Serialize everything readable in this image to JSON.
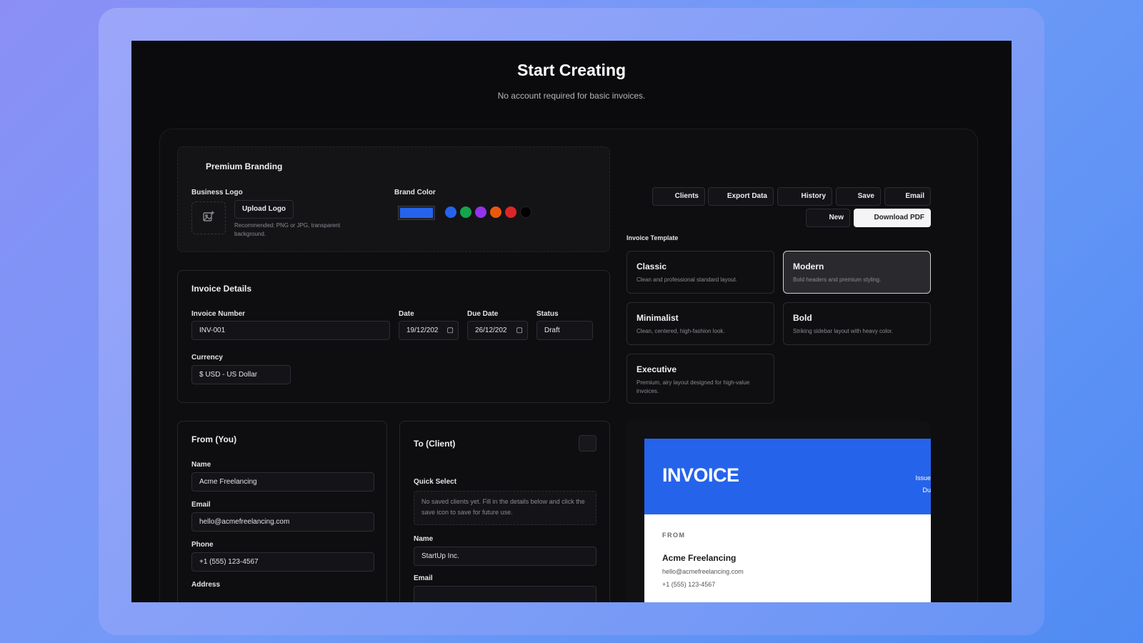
{
  "hero": {
    "title": "Start Creating",
    "subtitle": "No account required for basic invoices."
  },
  "branding": {
    "title": "Premium Branding",
    "logo_label": "Business Logo",
    "upload_label": "Upload Logo",
    "upload_note": "Recommended: PNG or JPG, transparent background.",
    "brand_color_label": "Brand Color",
    "selected_color": "#2563eb",
    "preset_colors": [
      "#2563eb",
      "#16a34a",
      "#9333ea",
      "#ea580c",
      "#dc2626",
      "#000000"
    ]
  },
  "invoice_details": {
    "title": "Invoice Details",
    "number_label": "Invoice Number",
    "number_value": "INV-001",
    "date_label": "Date",
    "date_value": "19/12/202",
    "due_label": "Due Date",
    "due_value": "26/12/202",
    "status_label": "Status",
    "status_value": "Draft",
    "currency_label": "Currency",
    "currency_value": "$ USD - US Dollar"
  },
  "from": {
    "title": "From (You)",
    "name_label": "Name",
    "name_value": "Acme Freelancing",
    "email_label": "Email",
    "email_value": "hello@acmefreelancing.com",
    "phone_label": "Phone",
    "phone_value": "+1 (555) 123-4567",
    "address_label": "Address"
  },
  "to": {
    "title": "To (Client)",
    "quick_select_label": "Quick Select",
    "quick_select_note": "No saved clients yet. Fill in the details below and click the save icon to save for future use.",
    "name_label": "Name",
    "name_value": "StartUp Inc.",
    "email_label": "Email"
  },
  "toolbar": {
    "clients": "Clients",
    "export": "Export Data",
    "history": "History",
    "save": "Save",
    "email": "Email",
    "new": "New",
    "download": "Download PDF"
  },
  "templates": {
    "label": "Invoice Template",
    "items": [
      {
        "name": "Classic",
        "desc": "Clean and professional standard layout."
      },
      {
        "name": "Modern",
        "desc": "Bold headers and premium styling."
      },
      {
        "name": "Minimalist",
        "desc": "Clean, centered, high-fashion look."
      },
      {
        "name": "Bold",
        "desc": "Striking sidebar layout with heavy color."
      },
      {
        "name": "Executive",
        "desc": "Premium, airy layout designed for high-value invoices."
      }
    ],
    "selected": "Modern"
  },
  "preview": {
    "title": "INVOICE",
    "issue_label": "Issue",
    "due_label": "Du",
    "from_label": "FROM",
    "from_name": "Acme Freelancing",
    "from_email": "hello@acmefreelancing.com",
    "from_phone": "+1 (555) 123-4567"
  }
}
